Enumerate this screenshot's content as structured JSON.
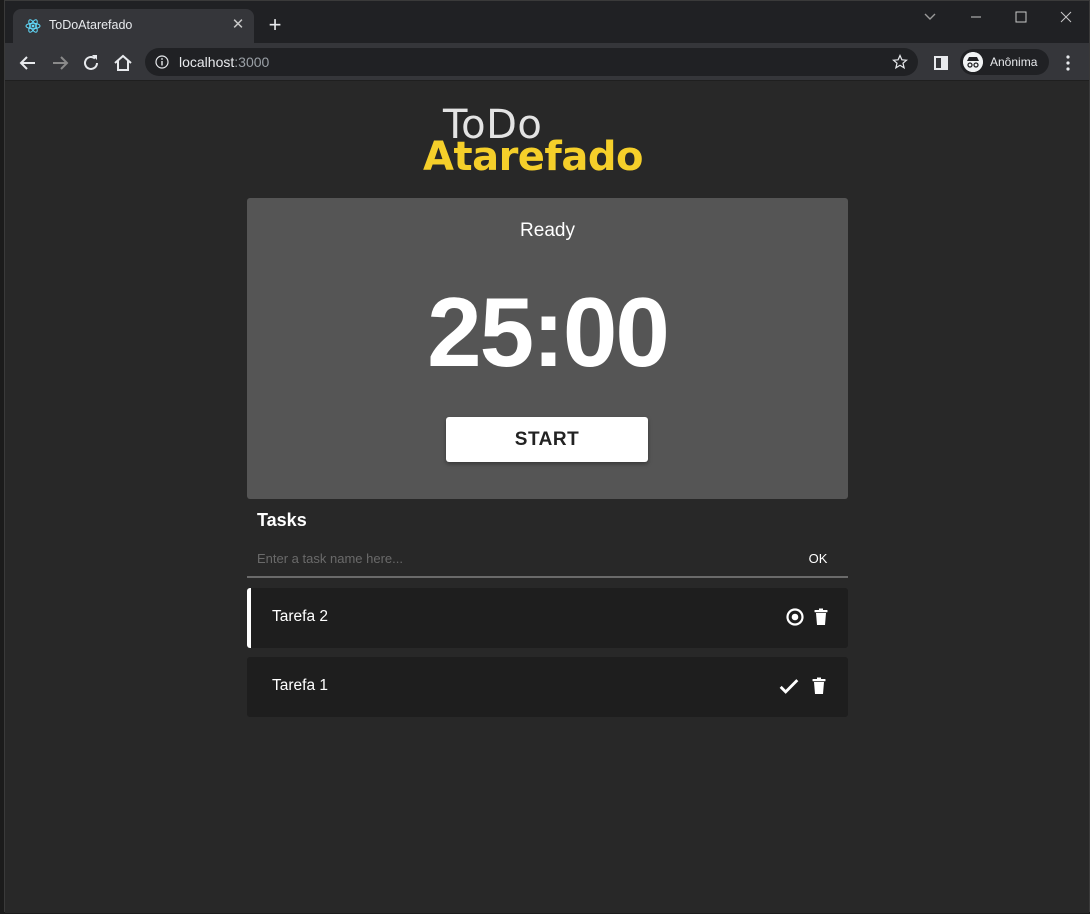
{
  "browser": {
    "tab_title": "ToDoAtarefado",
    "new_tab": "+",
    "tab_close": "✕",
    "url_host": "localhost",
    "url_port": ":3000",
    "profile_label": "Anônima"
  },
  "app": {
    "logo_top": "ToDo",
    "logo_bottom": "Atarefado",
    "timer_status": "Ready",
    "timer_time": "25:00",
    "start_label": "START",
    "tasks_title": "Tasks",
    "task_placeholder": "Enter a task name here...",
    "ok_label": "OK",
    "tasks": [
      {
        "label": "Tarefa 2",
        "state": "active"
      },
      {
        "label": "Tarefa 1",
        "state": "done"
      }
    ]
  },
  "colors": {
    "accent_yellow": "#f5cf2a",
    "timer_card": "#555555",
    "task_bg": "#1e1e1e",
    "page_bg": "#282828"
  }
}
